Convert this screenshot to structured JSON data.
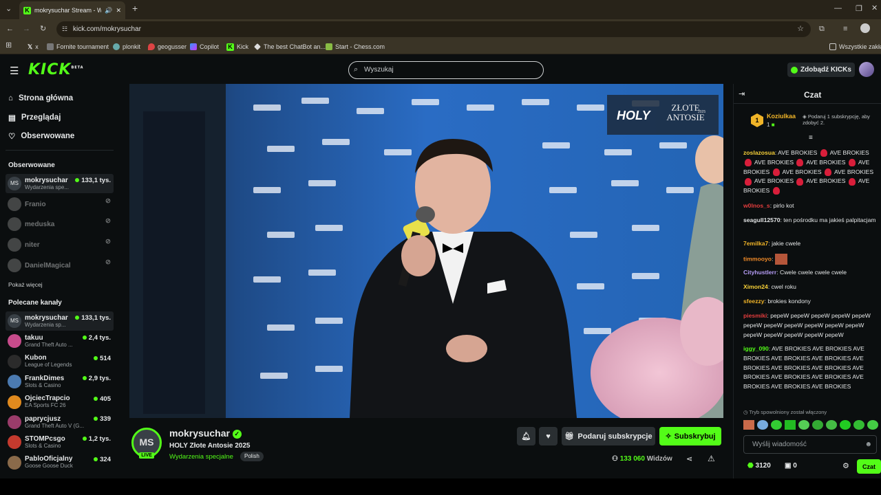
{
  "browser": {
    "tab_title": "mokrysuchar Stream - Watc",
    "url": "kick.com/mokrysuchar",
    "bookmarks": [
      "x",
      "Fornite tournament",
      "plonkit",
      "geogusser",
      "Copilot",
      "Kick",
      "The best ChatBot an...",
      "Start - Chess.com"
    ],
    "all_bookmarks": "Wszystkie zakład"
  },
  "header": {
    "logo": "KICK",
    "logo_beta": "BETA",
    "search_placeholder": "Wyszukaj",
    "get_kicks": "Zdobądź KICKs"
  },
  "sidebar": {
    "nav": [
      "Strona główna",
      "Przeglądaj",
      "Obserwowane"
    ],
    "followed_title": "Obserwowane",
    "followed": [
      {
        "name": "mokrysuchar",
        "category": "Wydarzenia spe...",
        "viewers": "133,1 tys.",
        "live": true,
        "initials": "MS"
      },
      {
        "name": "Franio",
        "live": false
      },
      {
        "name": "meduska",
        "live": false
      },
      {
        "name": "niter",
        "live": false
      },
      {
        "name": "DanielMagical",
        "live": false
      }
    ],
    "show_more": "Pokaż więcej",
    "recommended_title": "Polecane kanały",
    "recommended": [
      {
        "name": "mokrysuchar",
        "category": "Wydarzenia sp...",
        "viewers": "133,1 tys.",
        "color": "#394046",
        "initials": "MS"
      },
      {
        "name": "takuu",
        "category": "Grand Theft Auto ...",
        "viewers": "2,4 tys.",
        "color": "#c74b8b"
      },
      {
        "name": "Kubon",
        "category": "League of Legends",
        "viewers": "514",
        "color": "#2b2b2b"
      },
      {
        "name": "FrankDimes",
        "category": "Slots & Casino",
        "viewers": "2,9 tys.",
        "color": "#4b7ab0"
      },
      {
        "name": "OjciecTrapcio",
        "category": "EA Sports FC 26",
        "viewers": "405",
        "color": "#e08a1e"
      },
      {
        "name": "paprycjusz",
        "category": "Grand Theft Auto V (G...",
        "viewers": "339",
        "color": "#9a3c6a"
      },
      {
        "name": "STOMPcsgo",
        "category": "Slots & Casino",
        "viewers": "1,2 tys.",
        "color": "#c43a2e"
      },
      {
        "name": "PabloOficjalny",
        "category": "Goose Goose Duck",
        "viewers": "324",
        "color": "#8a6a4a"
      }
    ]
  },
  "video": {
    "overlay_holy": "HOLY",
    "overlay_title": "ZŁOTE ANTOSIE",
    "overlay_year": "2025"
  },
  "stream": {
    "channel": "mokrysuchar",
    "avatar_initials": "MS",
    "live_badge": "LIVE",
    "title": "HOLY Złote Antosie 2025",
    "category": "Wydarzenia specjalne",
    "language": "Polish",
    "gift_sub": "Podaruj subskrypcje",
    "subscribe": "Subskrybuj",
    "viewers": "133 060",
    "viewers_label": "Widzów"
  },
  "chat": {
    "title": "Czat",
    "top_gifter": "Koziulkaa",
    "top_gifter_count": "1",
    "gift_prompt": "Podaruj 1 subskrypcję, aby zdobyć 2.",
    "slow_mode": "Tryb spowolniony został włączony",
    "input_placeholder": "Wyślij wiadomość",
    "points": "3120",
    "points2": "0",
    "send": "Czat",
    "messages": [
      {
        "user": "zoslazosua",
        "color": "#f7d038",
        "text": "AVE BROKIES ♦ AVE BROKIES ♦ AVE BROKIES ♦ AVE BROKIES ♦ AVE BROKIES ♦ AVE BROKIES ♦ AVE BROKIES ♦ AVE BROKIES ♦ AVE BROKIES ♦ AVE BROKIES ♦"
      },
      {
        "user": "w0lnos_s",
        "color": "#e33d3d",
        "text": "pirlo kot"
      },
      {
        "user": "seagull12570",
        "color": "#e3e5e6",
        "text": "ten pośrodku ma jakieś palpitacjam"
      },
      {
        "user": "7emilka7",
        "color": "#f0b428",
        "text": "jakie cwele"
      },
      {
        "user": "timmooyo",
        "color": "#f08a28",
        "text": ""
      },
      {
        "user": "Cityhustlerr",
        "color": "#b59cf5",
        "text": "Cwele cwele cwele cwele"
      },
      {
        "user": "Ximon24",
        "color": "#f7d038",
        "text": "cwel roku"
      },
      {
        "user": "sfeezzy",
        "color": "#f0b428",
        "text": "brokies kondony"
      },
      {
        "user": "piesmiki",
        "color": "#e33d3d",
        "text": "pepeW pepeW pepeW pepeW pepeW pepeW pepeW pepeW pepeW pepeW pepeW pepeW pepeW pepeW pepeW pepeW"
      },
      {
        "user": "iggy_090",
        "color": "#53fc18",
        "text": "AVE BROKIES AVE BROKIES AVE BROKIES AVE BROKIES AVE BROKIES AVE BROKIES AVE BROKIES AVE BROKIES AVE BROKIES AVE BROKIES AVE BROKIES AVE BROKIES AVE BROKIES AVE BROKIES"
      }
    ]
  },
  "colors": {
    "accent": "#53fc18",
    "bg": "#0b0e0f",
    "browser": "#3a3426"
  }
}
